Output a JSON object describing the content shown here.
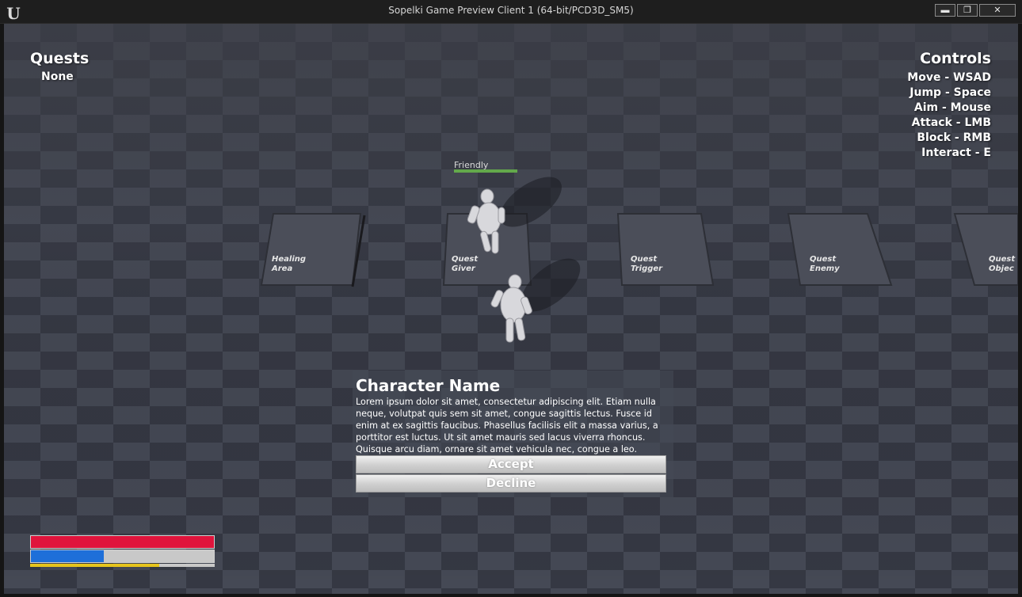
{
  "window": {
    "title": "Sopelki Game Preview Client 1 (64-bit/PCD3D_SM5)",
    "buttons": {
      "minimize": "▬",
      "maximize": "❐",
      "close": "✕"
    }
  },
  "hud": {
    "quests": {
      "heading": "Quests",
      "value": "None"
    },
    "controls": {
      "heading": "Controls",
      "items": [
        "Move - WSAD",
        "Jump - Space",
        "Aim - Mouse",
        "Attack - LMB",
        "Block - RMB",
        "Interact - E"
      ]
    },
    "npc": {
      "label": "Friendly",
      "health": 1.0
    }
  },
  "world_labels": [
    {
      "line1": "Healing",
      "line2": "Area"
    },
    {
      "line1": "Quest",
      "line2": "Giver"
    },
    {
      "line1": "Quest",
      "line2": "Trigger"
    },
    {
      "line1": "Quest",
      "line2": "Enemy"
    },
    {
      "line1": "Quest",
      "line2": "Objec"
    }
  ],
  "dialog": {
    "character_name": "Character Name",
    "text": "Lorem ipsum dolor sit amet, consectetur adipiscing elit. Etiam nulla neque, volutpat quis sem sit amet, congue sagittis lectus. Fusce id enim at ex sagittis faucibus. Phasellus facilisis elit a massa varius, a porttitor est luctus. Ut sit amet mauris sed lacus viverra rhoncus. Quisque arcu diam, ornare sit amet vehicula nec, congue a leo.",
    "accept_label": "Accept",
    "decline_label": "Decline"
  },
  "status": {
    "health": 1.0,
    "mana": 0.4,
    "stamina": 0.7,
    "colors": {
      "health": "#e0143c",
      "mana": "#1e6fd9",
      "stamina": "#e6c41c"
    }
  }
}
